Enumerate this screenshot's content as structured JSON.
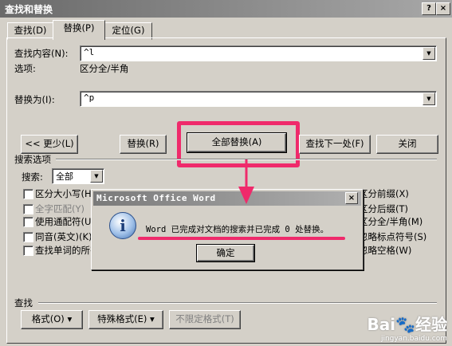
{
  "window": {
    "title": "查找和替换",
    "help": "?",
    "close": "×"
  },
  "tabs": [
    {
      "label": "查找(D)"
    },
    {
      "label": "替换(P)"
    },
    {
      "label": "定位(G)"
    }
  ],
  "find": {
    "label": "查找内容(N):",
    "value": "^l",
    "options_label": "选项:",
    "options_value": "区分全/半角"
  },
  "replace": {
    "label": "替换为(I):",
    "value": "^p"
  },
  "buttons": {
    "less": "<< 更少(L)",
    "replace": "替换(R)",
    "replace_all": "全部替换(A)",
    "find_next": "查找下一处(F)",
    "close": "关闭"
  },
  "search_options": {
    "heading": "搜索选项",
    "search_label": "搜索:",
    "search_value": "全部"
  },
  "checkboxes_left": [
    {
      "label": "区分大小写(H)",
      "enabled": true
    },
    {
      "label": "全字匹配(Y)",
      "enabled": false
    },
    {
      "label": "使用通配符(U)",
      "enabled": true
    },
    {
      "label": "同音(英文)(K)",
      "enabled": true
    },
    {
      "label": "查找单词的所有形式(英文)(W)",
      "enabled": true
    }
  ],
  "checkboxes_right": [
    {
      "label": "区分前缀(X)"
    },
    {
      "label": "区分后缀(T)"
    },
    {
      "label": "区分全/半角(M)"
    },
    {
      "label": "忽略标点符号(S)"
    },
    {
      "label": "忽略空格(W)"
    }
  ],
  "bottom": {
    "heading": "查找",
    "format": "格式(O) ▾",
    "special": "特殊格式(E) ▾",
    "no_format": "不限定格式(T)"
  },
  "message": {
    "title": "Microsoft Office Word",
    "close": "×",
    "text": "Word 已完成对文档的搜索并已完成 0 处替换。",
    "ok": "确定",
    "icon": "information-icon"
  },
  "watermark": {
    "brand": "Bai🐾经验",
    "url": "jingyan.baidu.com"
  },
  "colors": {
    "highlight": "#ef2a6b",
    "titlebar": "#8a8a8a"
  }
}
